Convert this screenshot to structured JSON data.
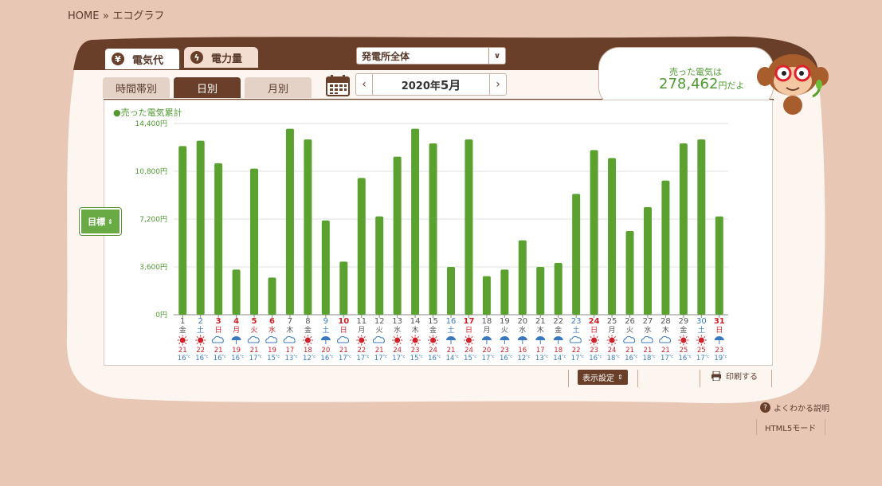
{
  "breadcrumb": {
    "home": "HOME",
    "sep": "»",
    "current": "エコグラフ"
  },
  "top_tabs": [
    {
      "label": "電気代",
      "icon": "yen-icon",
      "active": true
    },
    {
      "label": "電力量",
      "icon": "lightning-icon",
      "active": false
    }
  ],
  "plant_select": {
    "value": "発電所全体"
  },
  "sub_tabs": [
    {
      "label": "時間帯別",
      "active": false
    },
    {
      "label": "日別",
      "active": true
    },
    {
      "label": "月別",
      "active": false
    }
  ],
  "date_nav": {
    "prev": "‹",
    "label_year": "2020年",
    "label_month": "5月",
    "next": "›"
  },
  "sold": {
    "label": "売った電気は",
    "value": "278,462",
    "unit": "円だよ"
  },
  "legend": {
    "label": "売った電気累計"
  },
  "goal_button": {
    "label": "目標"
  },
  "footer": {
    "display_settings": "表示設定",
    "print": "印刷する",
    "help": "よくわかる説明",
    "html5": "HTML5モード"
  },
  "colors": {
    "bar": "#5aa12f",
    "frame": "#6a3f2a",
    "sun": "#d0202a",
    "rain": "#3a79c0",
    "cloud": "#3a79c0"
  },
  "chart_data": {
    "type": "bar",
    "title": "売った電気累計",
    "ylim": [
      0,
      14400
    ],
    "yticks": [
      "0円",
      "3,600円",
      "7,200円",
      "10,800円",
      "14,400円"
    ],
    "ytick_values": [
      0,
      3600,
      7200,
      10800,
      14400
    ],
    "days": [
      "1",
      "2",
      "3",
      "4",
      "5",
      "6",
      "7",
      "8",
      "9",
      "10",
      "11",
      "12",
      "13",
      "14",
      "15",
      "16",
      "17",
      "18",
      "19",
      "20",
      "21",
      "22",
      "23",
      "24",
      "25",
      "26",
      "27",
      "28",
      "29",
      "30",
      "31"
    ],
    "weekdays": [
      "金",
      "土",
      "日",
      "月",
      "火",
      "水",
      "木",
      "金",
      "土",
      "日",
      "月",
      "火",
      "水",
      "木",
      "金",
      "土",
      "日",
      "月",
      "火",
      "水",
      "木",
      "金",
      "土",
      "日",
      "月",
      "火",
      "水",
      "木",
      "金",
      "土",
      "日"
    ],
    "day_types": [
      "w",
      "sat",
      "sun",
      "hol",
      "hol",
      "hol",
      "w",
      "w",
      "sat",
      "sun",
      "w",
      "w",
      "w",
      "w",
      "w",
      "sat",
      "sun",
      "w",
      "w",
      "w",
      "w",
      "w",
      "sat",
      "sun",
      "w",
      "w",
      "w",
      "w",
      "w",
      "sat",
      "sun"
    ],
    "values": [
      12700,
      13100,
      11400,
      3400,
      11000,
      2800,
      14000,
      13200,
      7100,
      4000,
      10300,
      7400,
      11900,
      14000,
      12900,
      3600,
      13200,
      2900,
      3400,
      5600,
      3600,
      3900,
      9100,
      12400,
      11800,
      6300,
      8100,
      10100,
      12900,
      13200,
      7400
    ],
    "weather": [
      "sun",
      "sun",
      "cloud",
      "rain",
      "cloud",
      "cloud",
      "cloud",
      "sun",
      "rain",
      "cloud",
      "sun",
      "cloud",
      "sun",
      "sun",
      "sun",
      "rain",
      "sun",
      "rain",
      "rain",
      "rain",
      "rain",
      "rain",
      "cloud",
      "sun",
      "sun",
      "cloud",
      "cloud",
      "cloud",
      "sun",
      "sun",
      "rain"
    ],
    "temp_high": [
      "21",
      "22",
      "21",
      "19",
      "21",
      "19",
      "17",
      "18",
      "20",
      "21",
      "22",
      "21",
      "24",
      "23",
      "24",
      "21",
      "24",
      "20",
      "23",
      "16",
      "17",
      "18",
      "22",
      "23",
      "24",
      "21",
      "21",
      "21",
      "25",
      "25",
      "23"
    ],
    "temp_low": [
      "16",
      "16",
      "16",
      "16",
      "17",
      "15",
      "13",
      "12",
      "16",
      "17",
      "17",
      "17",
      "17",
      "15",
      "16",
      "14",
      "15",
      "17",
      "16",
      "12",
      "13",
      "14",
      "17",
      "16",
      "18",
      "16",
      "18",
      "17",
      "16",
      "17",
      "19"
    ]
  }
}
